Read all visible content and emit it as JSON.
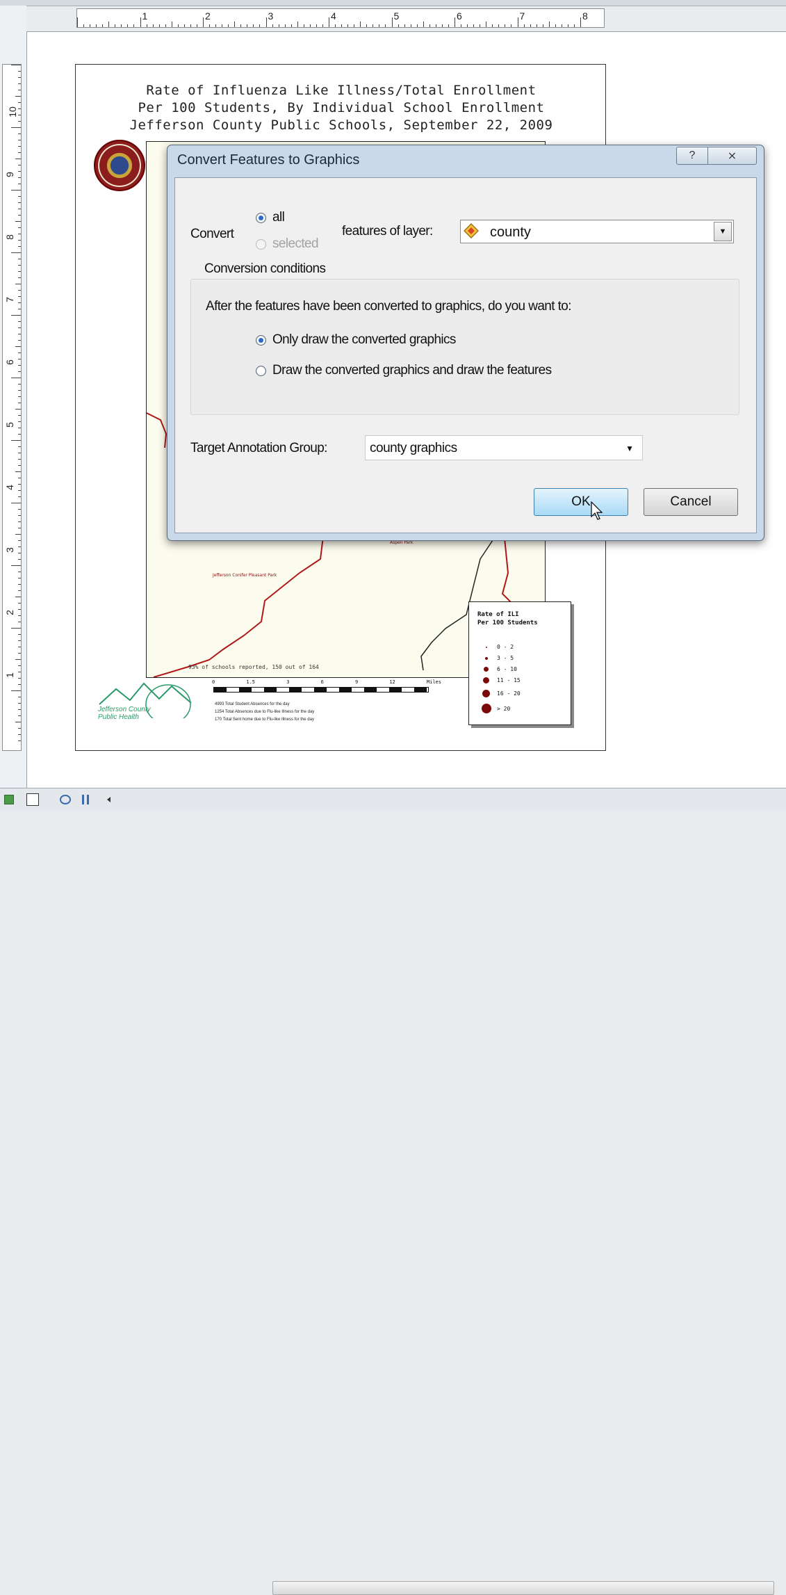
{
  "ruler": {
    "h_numbers": [
      "1",
      "2",
      "3",
      "4",
      "5",
      "6",
      "7",
      "8"
    ],
    "v_numbers": [
      "10",
      "9",
      "8",
      "7",
      "6",
      "5",
      "4",
      "3",
      "2",
      "1"
    ]
  },
  "map": {
    "title_lines": [
      "Rate of Influenza Like Illness/Total Enrollment",
      "Per 100 Students, By Individual School Enrollment",
      "Jefferson County Public Schools, September 22, 2009"
    ],
    "schools_reported": "93% of schools reported, 150 out of 164",
    "legend": {
      "title_line1": "Rate of ILI",
      "title_line2": "Per 100 Students",
      "items": [
        "0 - 2",
        "3 - 5",
        "6 - 10",
        "11 - 15",
        "16 - 20",
        "> 20"
      ]
    },
    "scale_labels": [
      "0",
      "1.5",
      "3",
      "6",
      "9",
      "12"
    ],
    "scale_unit": "Miles",
    "notes": [
      "4993 Total Student Absences for the day",
      "1254 Total Absences due to Flu-like Illness for the day",
      "170 Total Sent home due to Flu-like Illness for the day"
    ],
    "logo_text_line1": "Jefferson County",
    "logo_text_line2": "Public Health"
  },
  "dialog": {
    "title": "Convert Features to Graphics",
    "help_glyph": "?",
    "close_glyph": "⨯",
    "convert_label": "Convert",
    "option_all": "all",
    "option_selected": "selected",
    "features_of_layer_label": "features of layer:",
    "layer_value": "county",
    "group_title": "Conversion conditions",
    "question": "After the features have been converted to graphics, do you want to:",
    "option_only_draw": "Only draw the converted graphics",
    "option_draw_both": "Draw the converted graphics and draw the features",
    "target_label": "Target Annotation Group:",
    "target_value": "county graphics",
    "ok_label": "OK",
    "cancel_label": "Cancel"
  },
  "colors": {
    "accent": "#2a6ac8",
    "dialog_frame": "#c9d9ea",
    "ili_dot": "#7a0a0a",
    "road": "#b01818"
  }
}
